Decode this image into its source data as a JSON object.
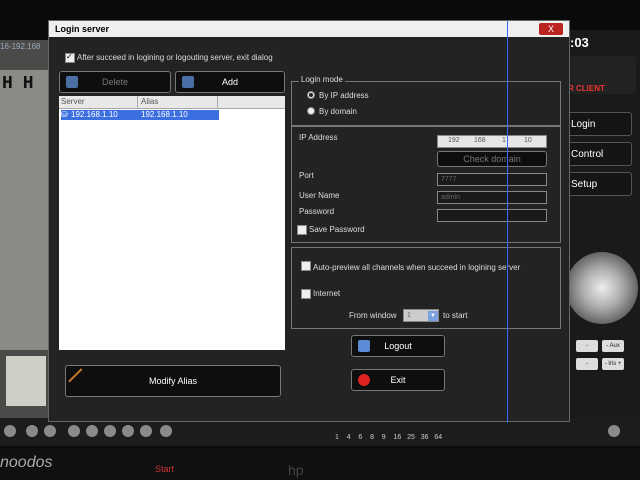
{
  "background": {
    "ip_fragment": "16-192.168",
    "time": ":03",
    "client_brand": "R CLIENT",
    "side_buttons": [
      "Login",
      "Control",
      "Setup"
    ],
    "ptz_labels": [
      "- Aux",
      "- Iris +"
    ],
    "channel_numbers": [
      "1",
      "4",
      "6",
      "8",
      "9",
      "16",
      "25",
      "36",
      "64"
    ],
    "vendor_logo": "noodos",
    "bottom_red_text": "Start",
    "bottom_gray_logo": "hp"
  },
  "dialog": {
    "title": "Login server",
    "close_label": "X",
    "exit_checkbox": {
      "label": "After succeed in logining or logouting server, exit dialog",
      "checked": true
    },
    "delete_label": "Delete",
    "add_label": "Add",
    "list": {
      "columns": [
        "Server",
        "Alias"
      ],
      "rows": [
        {
          "server": "192.168.1.10",
          "alias": "192.168.1.10"
        }
      ]
    },
    "modify_alias_label": "Modify Alias",
    "login_mode": {
      "title": "Login mode",
      "options": [
        "By IP address",
        "By domain"
      ],
      "selected": "By IP address"
    },
    "ip_label": "IP Address",
    "ip_octets": [
      "192",
      "168",
      "1",
      "10"
    ],
    "check_domain_label": "Check domain",
    "port_label": "Port",
    "port_value": "7777",
    "username_label": "User Name",
    "username_value": "admin",
    "password_label": "Password",
    "password_value": "",
    "save_password_label": "Save Password",
    "auto_preview_label": "Auto-preview all channels when succeed in logining server",
    "internet_label": "Internet",
    "from_window_label": "From window",
    "from_window_value": "1",
    "to_start_label": "to start",
    "logout_label": "Logout",
    "exit_label": "Exit"
  }
}
